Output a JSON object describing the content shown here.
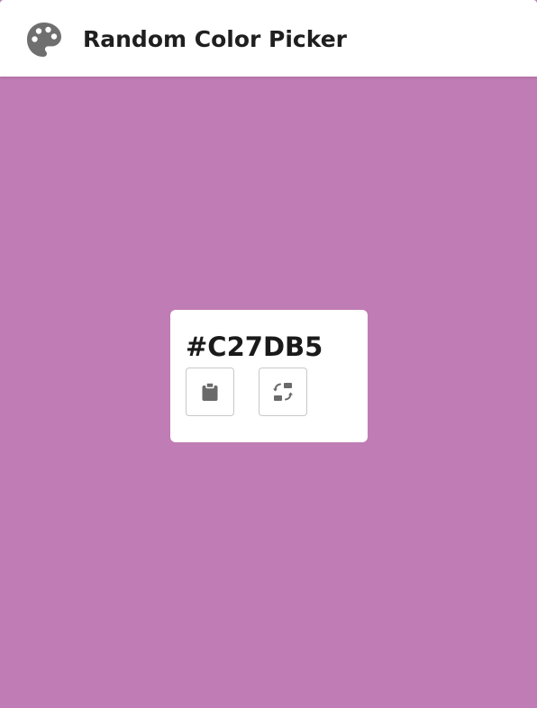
{
  "header": {
    "title": "Random Color Picker",
    "icon": "palette-icon"
  },
  "color": {
    "hex": "#C27DB5",
    "background": "#c07cb4"
  },
  "actions": {
    "copy_icon": "clipboard-icon",
    "refresh_icon": "swap-refresh-icon"
  }
}
